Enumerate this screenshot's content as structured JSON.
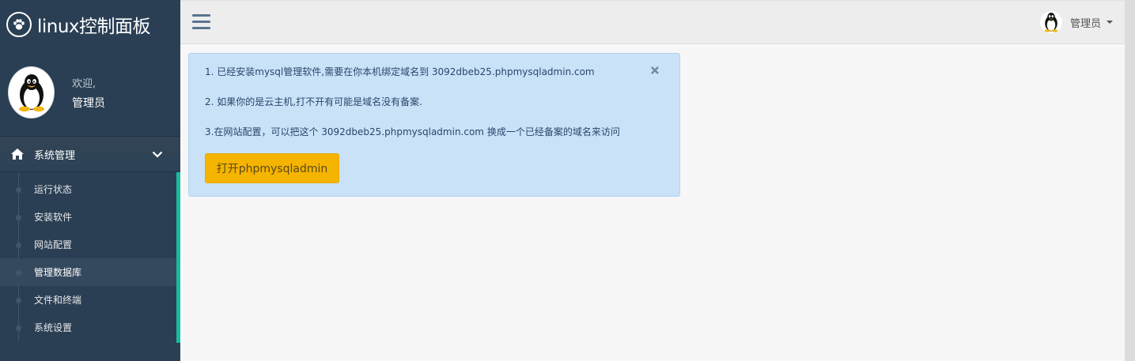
{
  "brand": {
    "title": "linux控制面板",
    "logo_icon": "paw-icon"
  },
  "profile": {
    "welcome": "欢迎,",
    "name": "管理员"
  },
  "menu": {
    "header_label": "系统管理",
    "items": [
      {
        "label": "运行状态"
      },
      {
        "label": "安装软件"
      },
      {
        "label": "网站配置"
      },
      {
        "label": "管理数据库",
        "active": true
      },
      {
        "label": "文件和终端"
      },
      {
        "label": "系统设置"
      }
    ]
  },
  "topbar": {
    "user_name": "管理员"
  },
  "alert": {
    "line1": "1. 已经安装mysql管理软件,需要在你本机绑定域名到 3092dbeb25.phpmysqladmin.com",
    "line2": "2. 如果你的是云主机,打不开有可能是域名没有备案.",
    "line3": "3.在网站配置，可以把这个 3092dbeb25.phpmysqladmin.com 换成一个已经备案的域名来访问",
    "button_label": "打开phpmysqladmin"
  },
  "colors": {
    "sidebar": "#2a3f54",
    "accent": "#1abb9c",
    "alert_bg": "#c9e2f8",
    "button": "#f5b400"
  }
}
